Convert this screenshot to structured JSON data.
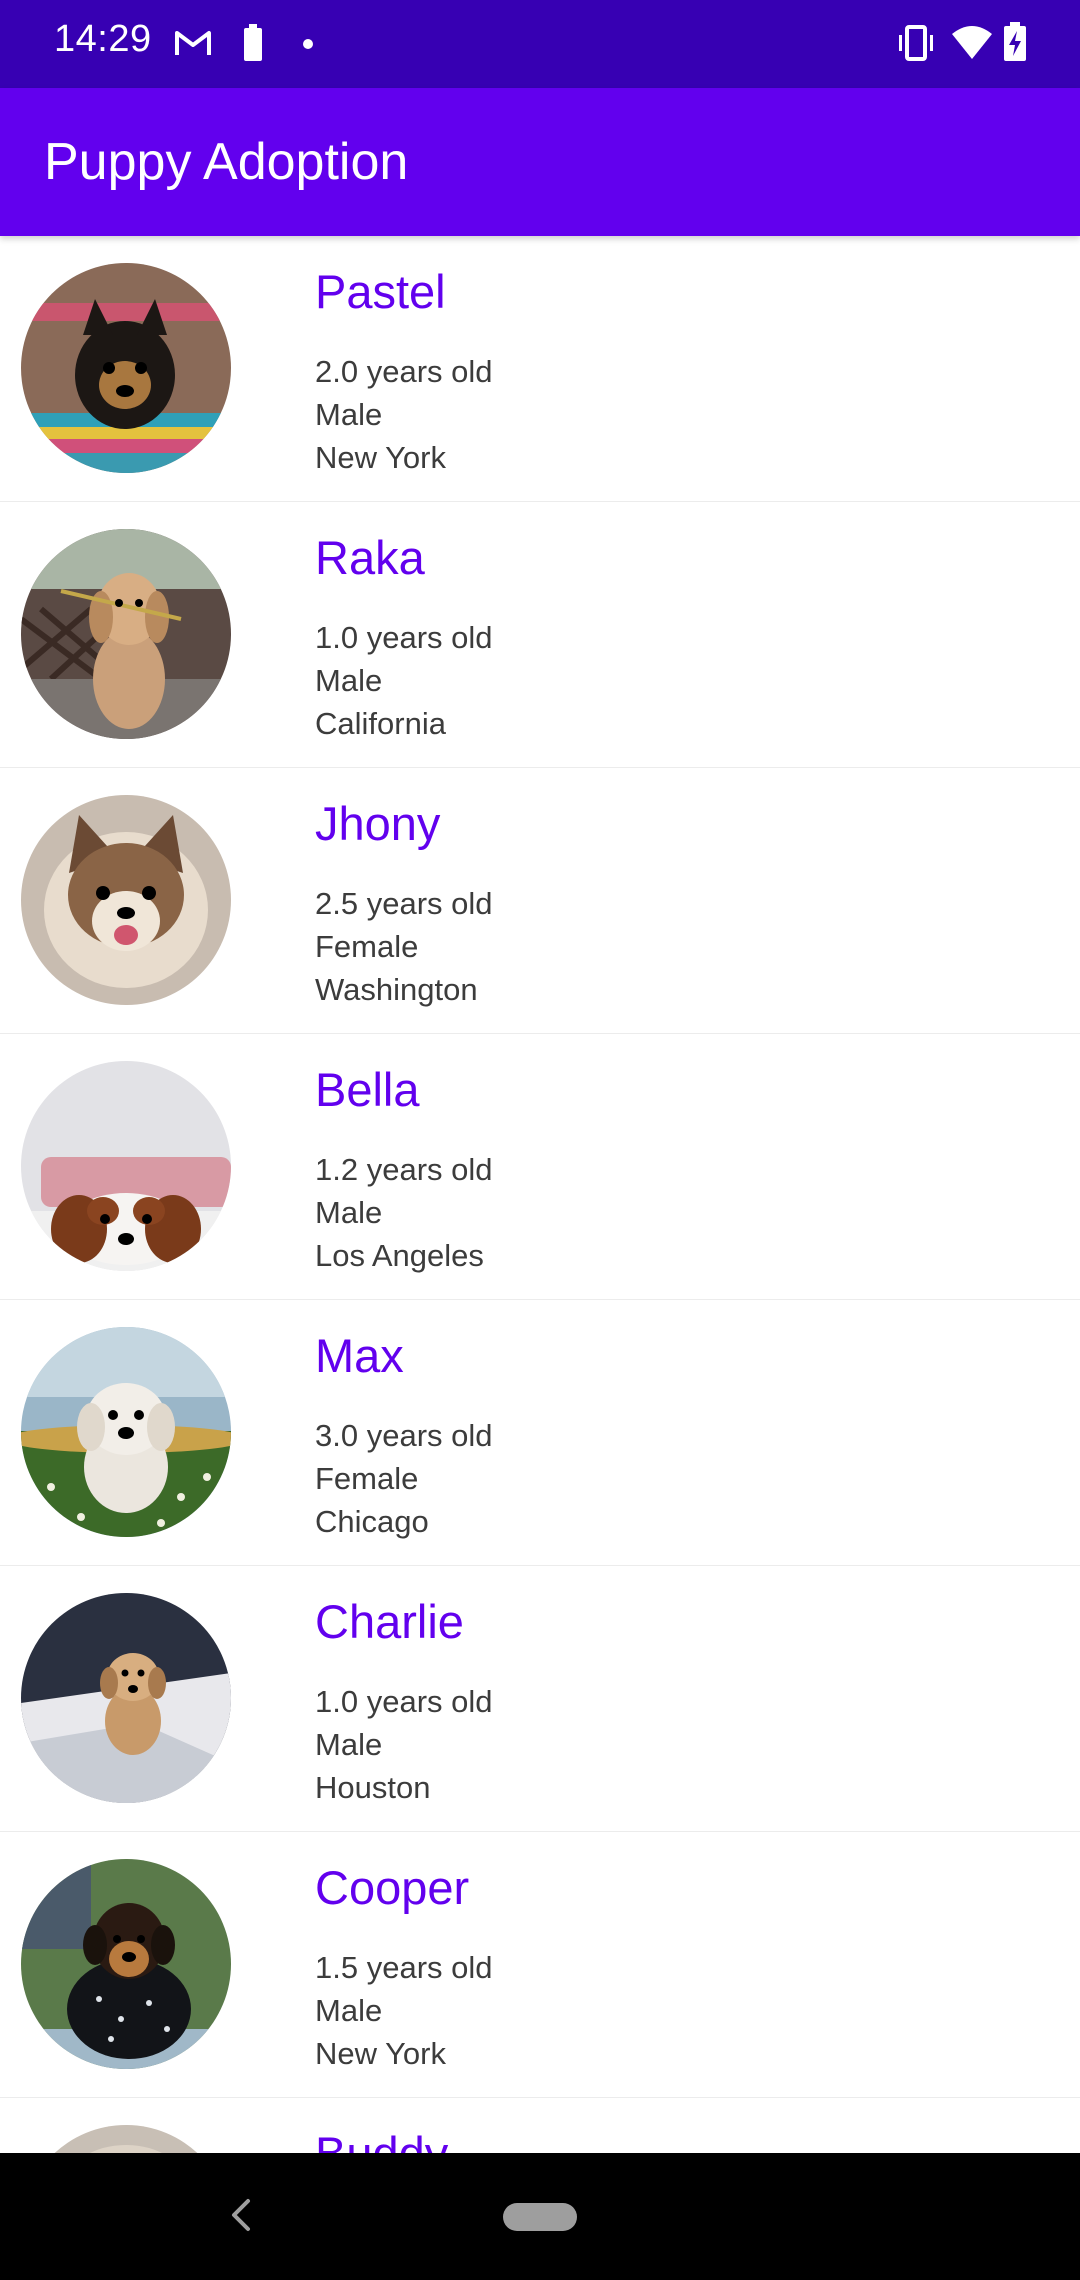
{
  "status_bar": {
    "time": "14:29",
    "left_icons": [
      "gmail-icon",
      "battery-saver-icon",
      "notification-dot-icon"
    ],
    "right_icons": [
      "vibrate-icon",
      "wifi-icon",
      "battery-charging-icon"
    ]
  },
  "app_bar": {
    "title": "Puppy Adoption"
  },
  "colors": {
    "status_bar": "#3700b3",
    "app_bar": "#6200ee",
    "name_text": "#6200ee"
  },
  "puppies": [
    {
      "name": "Pastel",
      "age": "2.0 years old",
      "gender": "Male",
      "location": "New York"
    },
    {
      "name": "Raka",
      "age": "1.0 years old",
      "gender": "Male",
      "location": "California"
    },
    {
      "name": "Jhony",
      "age": "2.5 years old",
      "gender": "Female",
      "location": "Washington"
    },
    {
      "name": "Bella",
      "age": "1.2 years old",
      "gender": "Male",
      "location": "Los Angeles"
    },
    {
      "name": "Max",
      "age": "3.0 years old",
      "gender": "Female",
      "location": "Chicago"
    },
    {
      "name": "Charlie",
      "age": "1.0 years old",
      "gender": "Male",
      "location": "Houston"
    },
    {
      "name": "Cooper",
      "age": "1.5 years old",
      "gender": "Male",
      "location": "New York"
    },
    {
      "name": "Buddy",
      "age": "",
      "gender": "",
      "location": ""
    }
  ],
  "nav_bar": {
    "icons": [
      "back-icon",
      "home-pill-icon"
    ]
  }
}
